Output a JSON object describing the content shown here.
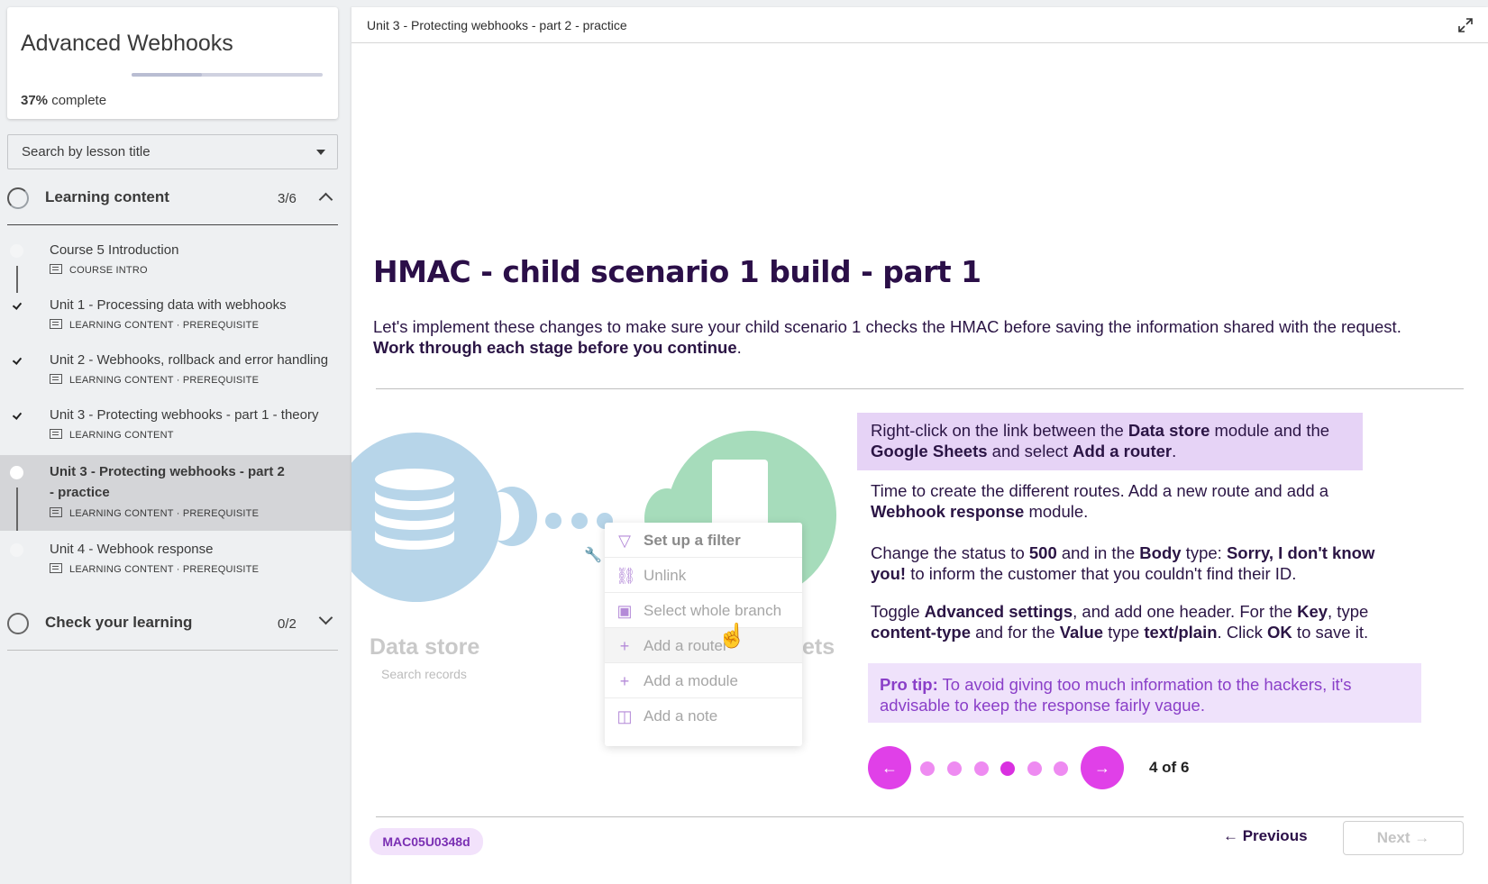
{
  "course": {
    "title": "Advanced Webhooks",
    "progress_value": "37%",
    "progress_suffix": " complete",
    "progress_fraction": 0.37
  },
  "search": {
    "placeholder": "Search by lesson title"
  },
  "sections": [
    {
      "title": "Learning content",
      "count": "3/6"
    },
    {
      "title": "Check your learning",
      "count": "0/2"
    }
  ],
  "lessons": [
    {
      "title": "Course 5 Introduction",
      "meta": "COURSE INTRO"
    },
    {
      "title": "Unit 1 - Processing data with webhooks",
      "meta": "LEARNING CONTENT · PREREQUISITE"
    },
    {
      "title": "Unit 2 - Webhooks, rollback and error handling",
      "meta": "LEARNING CONTENT · PREREQUISITE"
    },
    {
      "title": "Unit 3 - Protecting webhooks - part 1 - theory",
      "meta": "LEARNING CONTENT"
    },
    {
      "title": "Unit 3 - Protecting webhooks - part 2 - practice",
      "meta": "LEARNING CONTENT · PREREQUISITE"
    },
    {
      "title": "Unit 4 - Webhook response",
      "meta": "LEARNING CONTENT · PREREQUISITE"
    }
  ],
  "topbar": {
    "breadcrumb": "Unit 3 - Protecting webhooks - part 2 - practice"
  },
  "lesson": {
    "title": "HMAC - child scenario 1 build - part 1",
    "intro_plain": "Let's implement these changes to make sure your child scenario 1 checks the HMAC before saving the information shared with the request. ",
    "intro_bold": "Work through each stage before you continue",
    "intro_end": "."
  },
  "illustration": {
    "left_module": "Data store",
    "left_sub": "Search records",
    "right_module": "ets",
    "menu": [
      {
        "label": "Set up a filter",
        "icon": "filter-icon"
      },
      {
        "label": "Unlink",
        "icon": "unlink-icon"
      },
      {
        "label": "Select whole branch",
        "icon": "branch-icon"
      },
      {
        "label": "Add a router",
        "icon": "plus-icon"
      },
      {
        "label": "Add a module",
        "icon": "plus-icon"
      },
      {
        "label": "Add a note",
        "icon": "note-icon"
      }
    ]
  },
  "steps": {
    "s1": {
      "a": "Right-click on the link between the ",
      "b": "Data store",
      "c": " module and the ",
      "d": "Google Sheets",
      "e": " and select ",
      "f": "Add a router",
      "g": "."
    },
    "s2": {
      "a": "Time to create the different routes. Add a new route and add a ",
      "b": "Webhook response",
      "c": " module."
    },
    "s3": {
      "a": "Change the status to ",
      "b": "500",
      "c": " and in the ",
      "d": "Body",
      "e": " type: ",
      "f": "Sorry, I don't know you!",
      "g": " to inform the customer that you couldn't find their ID."
    },
    "s4": {
      "a": "Toggle ",
      "b": "Advanced settings",
      "c": ", and add one header. For the ",
      "d": "Key",
      "e": ", type ",
      "f": "content-type",
      "g": " and for the ",
      "h": "Value",
      "i": " type ",
      "j": "text/plain",
      "k": ". Click ",
      "l": "OK",
      "m": " to save it."
    },
    "protip_label": "Pro tip:",
    "protip_text": " To avoid giving too much information to the hackers, it's advisable to keep the response fairly vague."
  },
  "pager": {
    "label": "4 of 6",
    "current": 4,
    "total": 6,
    "prev_arrow": "←",
    "next_arrow": "→"
  },
  "footer": {
    "code": "MAC05U0348d",
    "previous_label": "← Previous",
    "next_label": "Next →"
  },
  "colors": {
    "accent": "#e040e8",
    "heading": "#2b0f48",
    "highlight": "#e6d3f6",
    "protip": "#8a3fc8"
  }
}
